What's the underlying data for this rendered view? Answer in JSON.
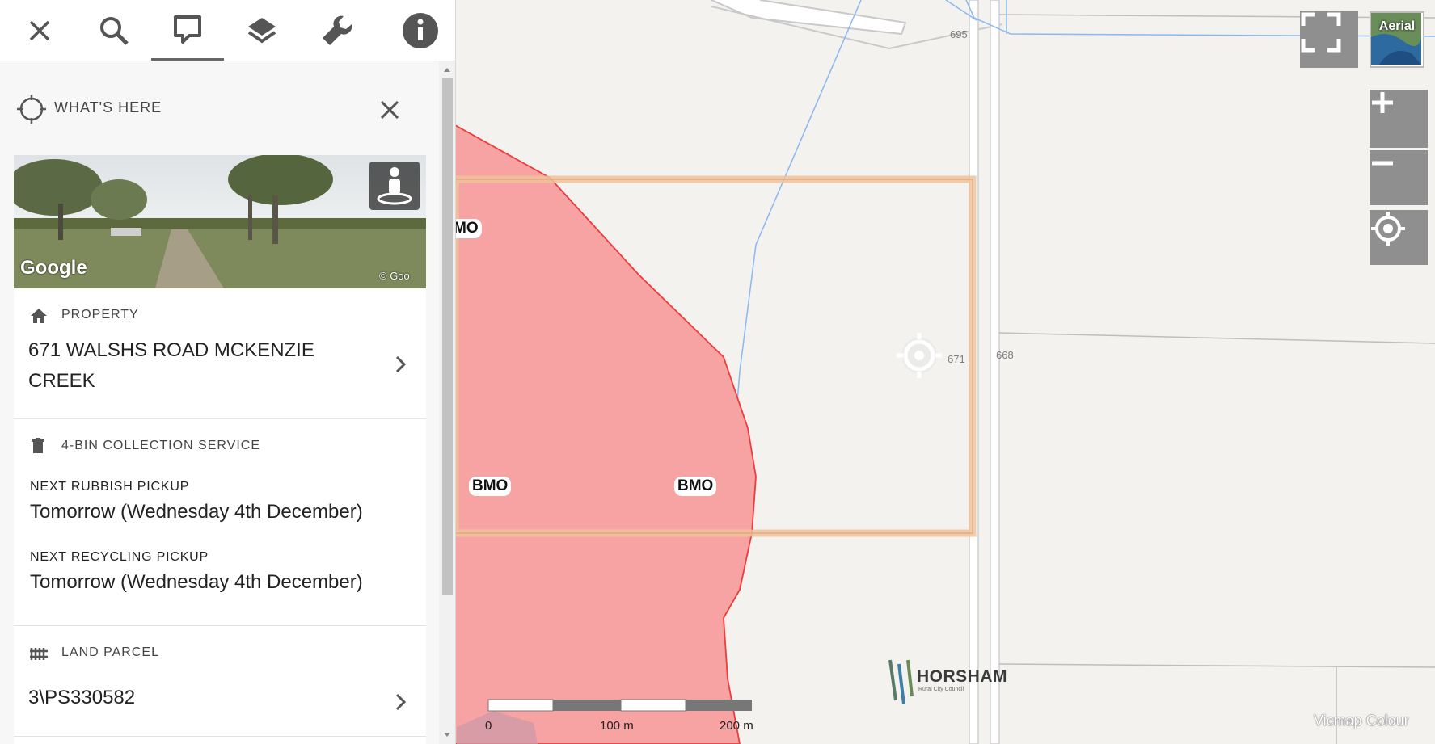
{
  "map": {
    "road_labels": [
      "695",
      "671",
      "668"
    ],
    "overlay_labels": [
      "MO",
      "BMO",
      "BMO"
    ],
    "overlay_color": "#f8a3a3",
    "parcel_outline_color": "#f0c29b",
    "attribution": "Vicmap Colour",
    "logo": {
      "name": "HORSHAM",
      "tagline": "Rural City Council"
    },
    "scale": {
      "labels": [
        "0",
        "100 m",
        "200 m"
      ]
    },
    "controls": {
      "aerial_label": "Aerial"
    }
  },
  "toolbar": {
    "icons": [
      "close-icon",
      "search-icon",
      "comment-icon",
      "layers-icon",
      "wrench-icon",
      "info-icon"
    ],
    "active": "comment-icon"
  },
  "whats_here": {
    "title": "WHAT'S HERE",
    "streetview_brand": "Google",
    "streetview_copyright": "© Goo"
  },
  "property": {
    "section_title": "PROPERTY",
    "address": "671 WALSHS ROAD MCKENZIE CREEK"
  },
  "bins": {
    "section_title": "4-BIN COLLECTION SERVICE",
    "rubbish_label": "NEXT RUBBISH PICKUP",
    "rubbish_value": "Tomorrow (Wednesday 4th December)",
    "recycling_label": "NEXT RECYCLING PICKUP",
    "recycling_value": "Tomorrow (Wednesday 4th December)"
  },
  "land_parcel": {
    "section_title": "LAND PARCEL",
    "value": "3\\PS330582"
  }
}
